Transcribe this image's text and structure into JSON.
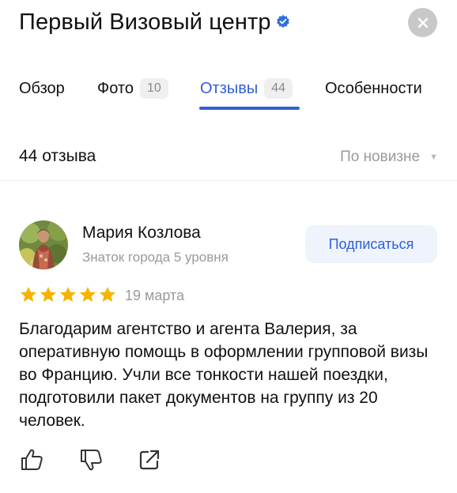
{
  "header": {
    "title": "Первый Визовый центр",
    "verified_icon": "verified-check-icon",
    "close_icon": "close-icon"
  },
  "tabs": [
    {
      "label": "Обзор",
      "count": null,
      "active": false
    },
    {
      "label": "Фото",
      "count": "10",
      "active": false
    },
    {
      "label": "Отзывы",
      "count": "44",
      "active": true
    },
    {
      "label": "Особенности",
      "count": null,
      "active": false
    }
  ],
  "reviews_header": {
    "count_label": "44 отзыва",
    "sort_label": "По новизне"
  },
  "review": {
    "author_name": "Мария Козлова",
    "author_level": "Знаток города 5 уровня",
    "subscribe_label": "Подписаться",
    "rating": 5,
    "rating_max": 5,
    "date": "19 марта",
    "text": "Благодарим агентство и агента Валерия, за оперативную помощь в оформлении групповой визы во Францию. Учли все тонкости нашей поездки, подготовили пакет документов на группу из 20 человек."
  },
  "actions": [
    "thumbs-up-icon",
    "thumbs-down-icon",
    "share-icon"
  ],
  "colors": {
    "accent": "#2f5fd8",
    "star": "#f5b400",
    "muted": "#9a9a9a",
    "badge_bg": "#efefef",
    "subscribe_bg": "#eef3fc"
  }
}
